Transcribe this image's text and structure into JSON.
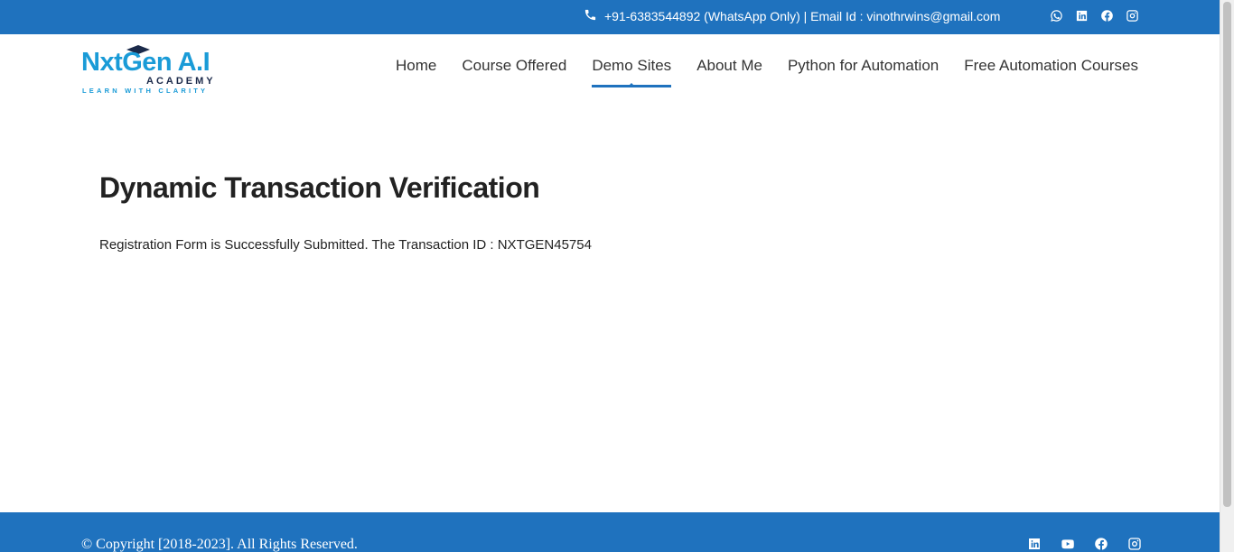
{
  "topbar": {
    "contact_text": "+91-6383544892 (WhatsApp Only) | Email Id : vinothrwins@gmail.com",
    "social_icons": [
      "whatsapp-icon",
      "linkedin-icon",
      "facebook-icon",
      "instagram-icon"
    ]
  },
  "logo": {
    "main": "NxtGen A.I",
    "sub": "ACADEMY",
    "tagline": "LEARN WITH CLARITY"
  },
  "nav": {
    "items": [
      {
        "label": "Home"
      },
      {
        "label": "Course Offered"
      },
      {
        "label": "Demo Sites",
        "active": true
      },
      {
        "label": "About Me"
      },
      {
        "label": "Python for Automation"
      },
      {
        "label": "Free Automation Courses"
      }
    ]
  },
  "main": {
    "title": "Dynamic Transaction Verification",
    "message": "Registration Form is Successfully Submitted. The Transaction ID : NXTGEN45754"
  },
  "footer": {
    "copyright": "© Copyright [2018-2023]. All Rights Reserved.",
    "social_icons": [
      "linkedin-icon",
      "youtube-icon",
      "facebook-icon",
      "instagram-icon"
    ]
  },
  "colors": {
    "brand_blue": "#1f72be",
    "logo_blue": "#1a9bd7"
  }
}
